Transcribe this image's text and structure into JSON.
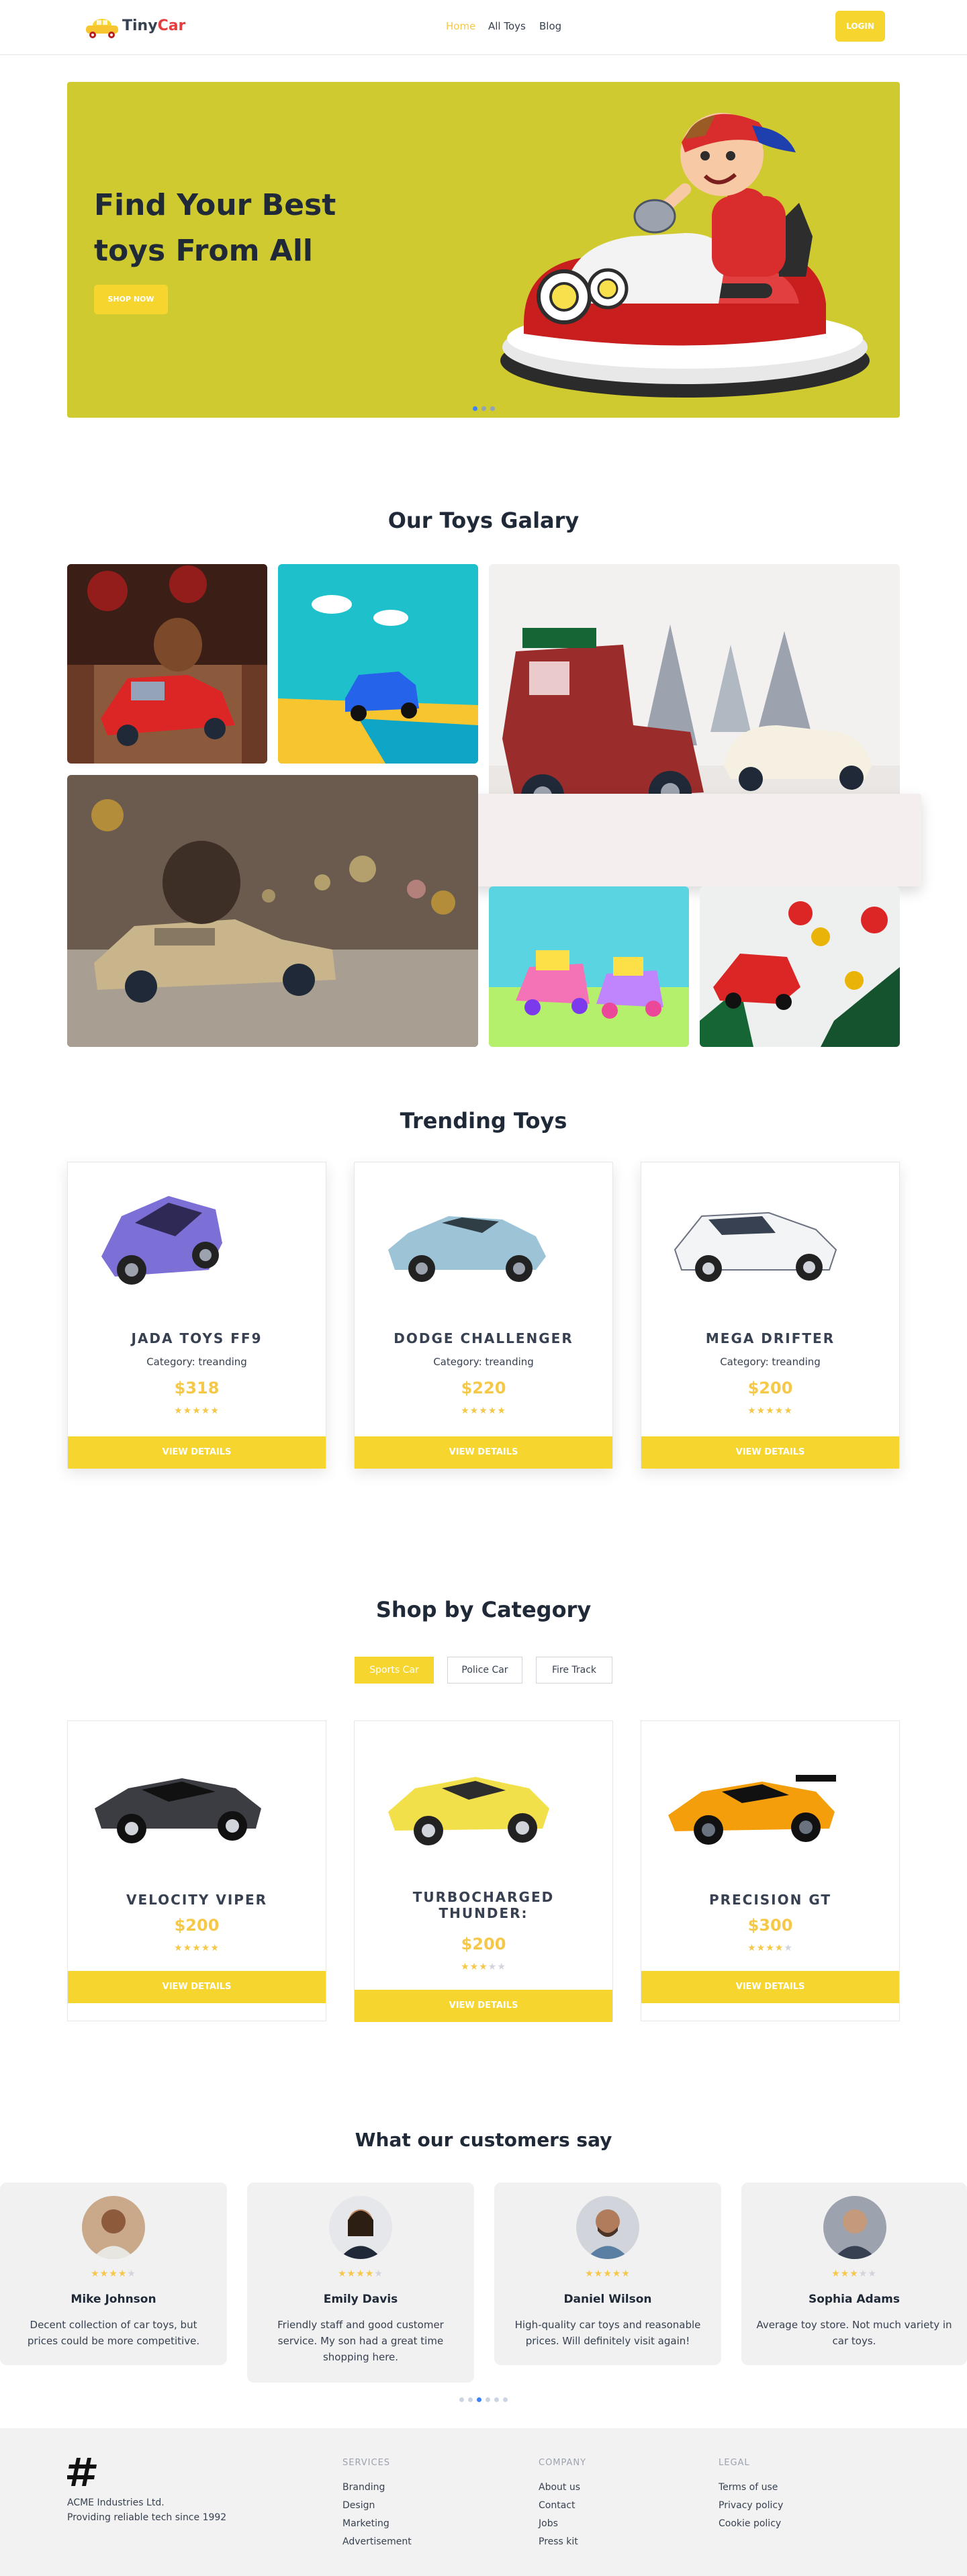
{
  "header": {
    "brand_first": "Tiny",
    "brand_second": "Car",
    "nav": [
      "Home",
      "All Toys",
      "Blog"
    ],
    "login_label": "LOGIN"
  },
  "hero": {
    "title_line1": "Find Your Best",
    "title_line2": "toys From All",
    "cta_label": "SHOP NOW",
    "slide_count": 3,
    "active_slide": 1
  },
  "gallery": {
    "title": "Our Toys Galary"
  },
  "trending": {
    "title": "Trending Toys",
    "items": [
      {
        "name": "JADA TOYS FF9",
        "category": "Category: treanding",
        "price": "$318",
        "rating": 5,
        "button": "VIEW DETAILS"
      },
      {
        "name": "DODGE CHALLENGER",
        "category": "Category: treanding",
        "price": "$220",
        "rating": 5,
        "button": "VIEW DETAILS"
      },
      {
        "name": "MEGA DRIFTER",
        "category": "Category: treanding",
        "price": "$200",
        "rating": 5,
        "button": "VIEW DETAILS"
      }
    ]
  },
  "category": {
    "title": "Shop by Category",
    "tabs": [
      "Sports Car",
      "Police Car",
      "Fire Track"
    ],
    "active_tab": "Sports Car",
    "items": [
      {
        "name": "VELOCITY VIPER",
        "price": "$200",
        "rating": 5,
        "button": "VIEW DETAILS"
      },
      {
        "name_line1": "TURBOCHARGED",
        "name_line2": "THUNDER:",
        "price": "$200",
        "rating": 3,
        "button": "VIEW DETAILS"
      },
      {
        "name": "PRECISION GT",
        "price": "$300",
        "rating": 4,
        "button": "VIEW DETAILS"
      }
    ]
  },
  "reviews": {
    "title": "What our customers say",
    "items": [
      {
        "name": "Mike Johnson",
        "rating": 4,
        "text": "Decent collection of car toys, but prices could be more competitive."
      },
      {
        "name": "Emily Davis",
        "rating": 4,
        "text": "Friendly staff and good customer service. My son had a great time shopping here."
      },
      {
        "name": "Daniel Wilson",
        "rating": 5,
        "text": "High-quality car toys and reasonable prices. Will definitely visit again!"
      },
      {
        "name": "Sophia Adams",
        "rating": 3,
        "text": "Average toy store. Not much variety in car toys."
      }
    ],
    "dot_count": 6,
    "active_dot": 2
  },
  "footer": {
    "company_name": "ACME Industries Ltd.",
    "company_tagline": "Providing reliable tech since 1992",
    "services_head": "SERVICES",
    "services": [
      "Branding",
      "Design",
      "Marketing",
      "Advertisement"
    ],
    "company_head": "COMPANY",
    "company_links": [
      "About us",
      "Contact",
      "Jobs",
      "Press kit"
    ],
    "legal_head": "LEGAL",
    "legal_links": [
      "Terms of use",
      "Privacy policy",
      "Cookie policy"
    ]
  },
  "colors": {
    "accent": "#f7d52f",
    "hero_bg": "#d0ca31",
    "price": "#f6c84a",
    "brand_red": "#e53e3e"
  }
}
